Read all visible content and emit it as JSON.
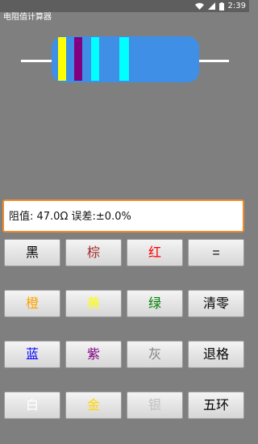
{
  "status": {
    "time": "2:39"
  },
  "app": {
    "title": "电阻值计算器"
  },
  "resistor": {
    "body_color": "#3f8fe6",
    "bands": [
      {
        "color": "#ffff00"
      },
      {
        "color": "#800080"
      },
      {
        "color": "#00ffff"
      },
      {
        "color": "#00ffff"
      }
    ]
  },
  "display": {
    "text": "阻值: 47.0Ω 误差:±0.0%"
  },
  "keys": [
    {
      "label": "黑",
      "color": "#000000"
    },
    {
      "label": "棕",
      "color": "#a52a2a"
    },
    {
      "label": "红",
      "color": "#ff0000"
    },
    {
      "label": "=",
      "color": "#000000"
    },
    {
      "label": "橙",
      "color": "#ffa500"
    },
    {
      "label": "黄",
      "color": "#ffff00"
    },
    {
      "label": "绿",
      "color": "#008000"
    },
    {
      "label": "清零",
      "color": "#000000"
    },
    {
      "label": "蓝",
      "color": "#0000ff"
    },
    {
      "label": "紫",
      "color": "#800080"
    },
    {
      "label": "灰",
      "color": "#808080"
    },
    {
      "label": "退格",
      "color": "#000000"
    },
    {
      "label": "白",
      "color": "#ffffff"
    },
    {
      "label": "金",
      "color": "#ffd700"
    },
    {
      "label": "银",
      "color": "#c0c0c0"
    },
    {
      "label": "五环",
      "color": "#000000"
    }
  ]
}
